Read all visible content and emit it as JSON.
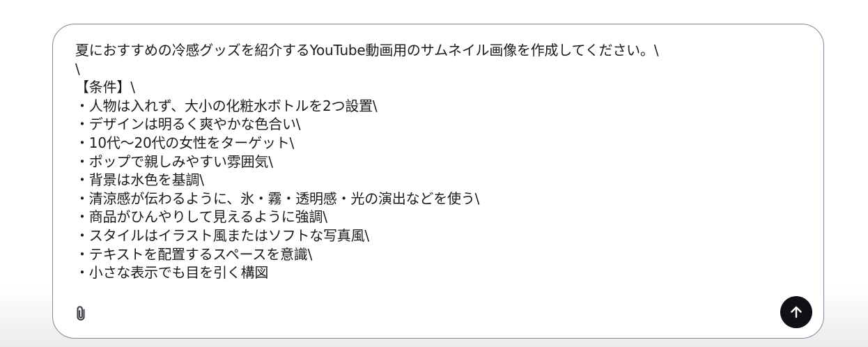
{
  "composer": {
    "prompt_text": "夏におすすめの冷感グッズを紹介するYouTube動画用のサムネイル画像を作成してください。\\\n\\\n【条件】\\\n・人物は入れず、大小の化粧水ボトルを2つ設置\\\n・デザインは明るく爽やかな色合い\\\n・10代〜20代の女性をターゲット\\\n・ポップで親しみやすい雰囲気\\\n・背景は水色を基調\\\n・清涼感が伝わるように、氷・霧・透明感・光の演出などを使う\\\n・商品がひんやりして見えるように強調\\\n・スタイルはイラスト風またはソフトな写真風\\\n・テキストを配置するスペースを意識\\\n・小さな表示でも目を引く構図",
    "attach_icon": "paperclip-icon",
    "send_icon": "arrow-up-icon"
  },
  "colors": {
    "composer_border": "#7f8b99",
    "send_button_bg": "#0f1115",
    "text": "#1a1a1a"
  }
}
